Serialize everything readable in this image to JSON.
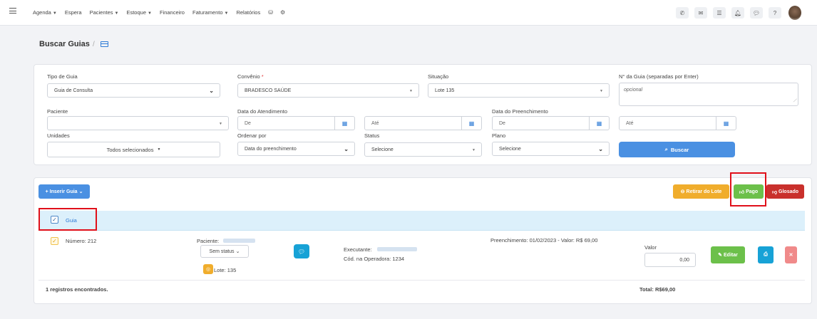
{
  "nav": {
    "menu": [
      {
        "label": "Agenda",
        "dropdown": true
      },
      {
        "label": "Espera",
        "dropdown": false
      },
      {
        "label": "Pacientes",
        "dropdown": true
      },
      {
        "label": "Estoque",
        "dropdown": true
      },
      {
        "label": "Financeiro",
        "dropdown": false
      },
      {
        "label": "Faturamento",
        "dropdown": true
      },
      {
        "label": "Relatórios",
        "dropdown": false
      }
    ],
    "extra_icons": [
      "database-icon",
      "settings-icon"
    ],
    "right_icons": [
      "phone-icon",
      "inbox-icon",
      "list-icon",
      "bell-icon",
      "chat-icon",
      "help-icon"
    ]
  },
  "page": {
    "title": "Buscar Guias",
    "separator": "/"
  },
  "filters": {
    "tipo_guia": {
      "label": "Tipo de Guia",
      "value": "Guia de Consulta"
    },
    "convenio": {
      "label": "Convênio",
      "required_mark": "*",
      "value": "BRADESCO SAÚDE"
    },
    "situacao": {
      "label": "Situação",
      "value": "Lote 135"
    },
    "num_guia": {
      "label": "N° da Guia (separadas por Enter)",
      "placeholder": "opcional"
    },
    "paciente": {
      "label": "Paciente",
      "value": ""
    },
    "data_atendimento": {
      "label": "Data do Atendimento",
      "from": "De",
      "to": "Até"
    },
    "data_preenchimento": {
      "label": "Data do Preenchimento",
      "from": "De",
      "to": "Até"
    },
    "unidades": {
      "label": "Unidades",
      "value": "Todos selecionados"
    },
    "ordenar_por": {
      "label": "Ordenar por",
      "value": "Data do preenchimento"
    },
    "status": {
      "label": "Status",
      "value": "Selecione"
    },
    "plano": {
      "label": "Plano",
      "value": "Selecione"
    },
    "buscar_label": "Buscar"
  },
  "results": {
    "inserir_label": "Inserir Guia",
    "retirar_label": "Retirar do Lote",
    "pago_label": "Pago",
    "glosado_label": "Glosado",
    "header_label": "Guia",
    "row": {
      "numero": "Número: 212",
      "paciente_label": "Paciente:",
      "status_select": "Sem status",
      "executante_label": "Executante:",
      "cod_operadora": "Cód. na Operadora: 1234",
      "lote": "Lote: 135",
      "preenchimento": "Preenchimento: 01/02/2023 - Valor: R$ 69,00",
      "valor_label": "Valor",
      "valor_value": "0,00",
      "editar_label": "Editar"
    },
    "count_text": "1 registros encontrados.",
    "total_text": "Total: R$69,00"
  },
  "colors": {
    "primary": "#4a90e2",
    "warning": "#f0ad2c",
    "success": "#6cc04a",
    "danger": "#d9363e",
    "highlight": "#e0101a"
  }
}
